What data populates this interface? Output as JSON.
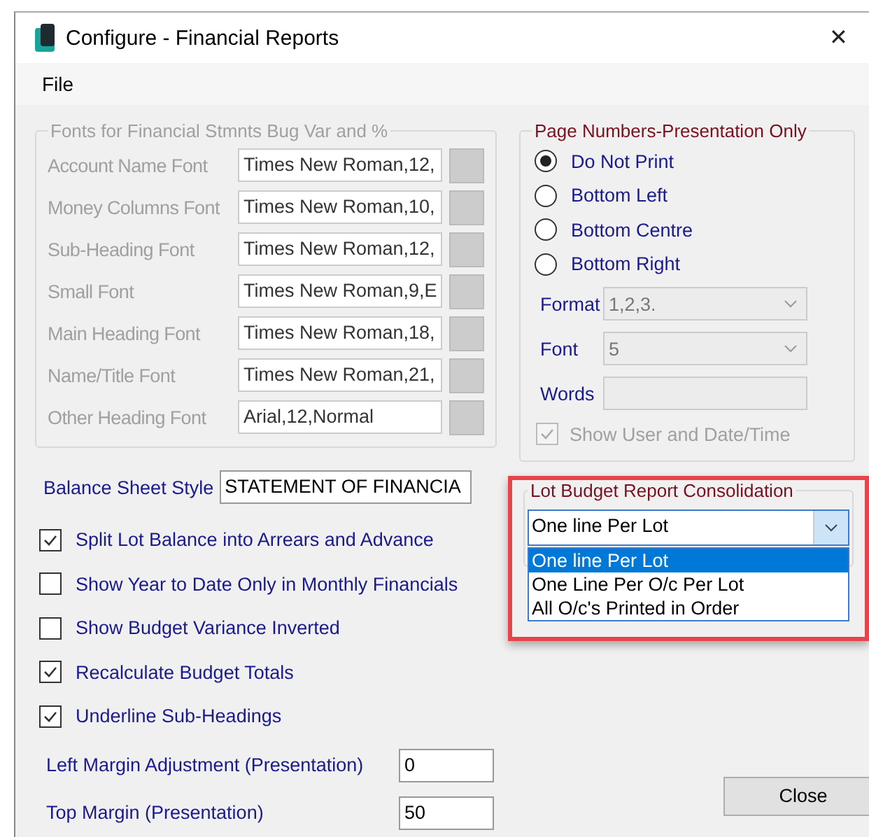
{
  "window": {
    "title": "Configure - Financial Reports",
    "close": "✕"
  },
  "menu": [
    "File"
  ],
  "fonts_group": {
    "title": "Fonts for Financial Stmnts Bug Var and %",
    "disabled": true,
    "rows": [
      {
        "label": "Account Name Font",
        "value": "Times New Roman,12,"
      },
      {
        "label": "Money Columns Font",
        "value": "Times New Roman,10,"
      },
      {
        "label": "Sub-Heading Font",
        "value": "Times New Roman,12,"
      },
      {
        "label": "Small Font",
        "value": "Times New Roman,9,E"
      },
      {
        "label": "Main Heading Font",
        "value": "Times New Roman,18,"
      },
      {
        "label": "Name/Title Font",
        "value": "Times New Roman,21,"
      },
      {
        "label": "Other Heading Font",
        "value": "Arial,12,Normal"
      }
    ]
  },
  "balance_sheet_style": {
    "label": "Balance Sheet Style",
    "value": "STATEMENT OF FINANCIA"
  },
  "options": [
    {
      "label": "Split Lot Balance into Arrears and Advance",
      "checked": true
    },
    {
      "label": "Show Year to Date Only in Monthly Financials",
      "checked": false
    },
    {
      "label": "Show Budget Variance Inverted",
      "checked": false
    },
    {
      "label": "Recalculate Budget Totals",
      "checked": true
    },
    {
      "label": "Underline Sub-Headings",
      "checked": true
    }
  ],
  "margins": [
    {
      "label": "Left Margin Adjustment (Presentation)",
      "value": "0"
    },
    {
      "label": "Top Margin (Presentation)",
      "value": "50"
    }
  ],
  "page_numbers": {
    "title": "Page Numbers-Presentation Only",
    "positions": [
      {
        "label": "Do Not Print",
        "selected": true
      },
      {
        "label": "Bottom Left",
        "selected": false
      },
      {
        "label": "Bottom Centre",
        "selected": false
      },
      {
        "label": "Bottom Right",
        "selected": false
      }
    ],
    "format": {
      "label": "Format",
      "value": "1,2,3.",
      "disabled": true
    },
    "font": {
      "label": "Font",
      "value": "5",
      "disabled": true
    },
    "words": {
      "label": "Words",
      "disabled": true
    },
    "show_user": {
      "label": "Show User and Date/Time",
      "checked": true,
      "disabled": true
    }
  },
  "lot_budget": {
    "title": "Lot Budget Report Consolidation",
    "value": "One line Per Lot",
    "highlighted": true,
    "expanded": true,
    "options": [
      {
        "label": "One line Per Lot",
        "selected": true
      },
      {
        "label": "One Line Per O/c Per Lot",
        "selected": false
      },
      {
        "label": "All O/c's Printed in Order",
        "selected": false
      }
    ]
  },
  "buttons": [
    "Close"
  ]
}
